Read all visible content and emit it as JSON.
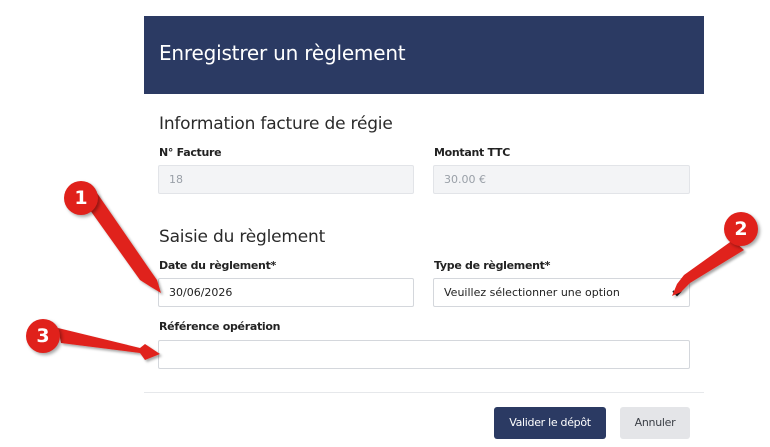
{
  "modal": {
    "title": "Enregistrer un règlement",
    "invoice_section_title": "Information facture de régie",
    "invoice_number_label": "N° Facture",
    "invoice_number_value": "18",
    "amount_label": "Montant TTC",
    "amount_value": "30.00 €",
    "payment_section_title": "Saisie du règlement",
    "payment_date_label": "Date du règlement*",
    "payment_date_value": "30/06/2026",
    "payment_type_label": "Type de règlement*",
    "payment_type_value": "Veuillez sélectionner une option",
    "reference_label": "Référence opération",
    "reference_value": "",
    "submit_label": "Valider le dépôt",
    "cancel_label": "Annuler"
  },
  "annotations": {
    "badge_1": "1",
    "badge_2": "2",
    "badge_3": "3"
  },
  "colors": {
    "header_bg": "#2b3a63",
    "primary_button": "#2b3a63",
    "annotation_red": "#e0211b"
  }
}
